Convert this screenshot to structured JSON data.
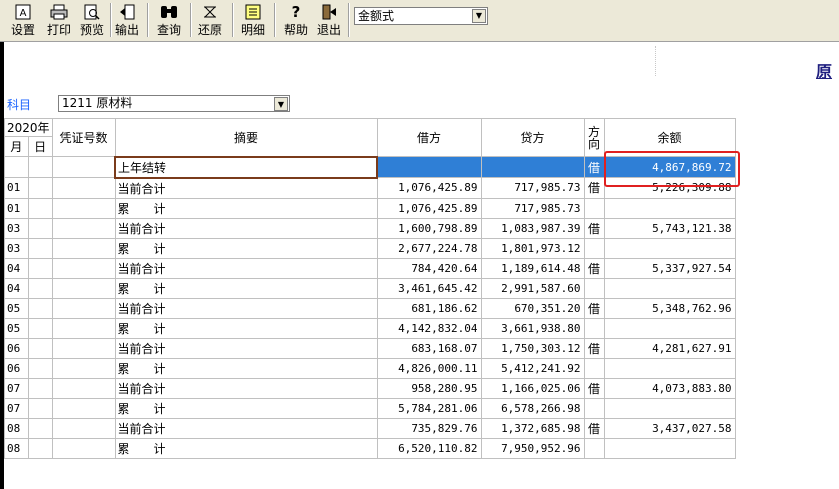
{
  "toolbar": {
    "buttons": [
      {
        "label": "设置",
        "icon": "settings-icon"
      },
      {
        "label": "打印",
        "icon": "printer-icon"
      },
      {
        "label": "预览",
        "icon": "preview-icon"
      },
      {
        "label": "输出",
        "icon": "export-icon"
      },
      {
        "label": "查询",
        "icon": "binoculars-icon"
      },
      {
        "label": "还原",
        "icon": "restore-icon"
      },
      {
        "label": "明细",
        "icon": "detail-icon"
      },
      {
        "label": "帮助",
        "icon": "help-icon"
      },
      {
        "label": "退出",
        "icon": "exit-icon"
      }
    ],
    "format_value": "金额式"
  },
  "title_fragment": "原",
  "account": {
    "label": "科目",
    "value": "1211 原材料"
  },
  "table": {
    "headers": {
      "year": "2020年",
      "month": "月",
      "day": "日",
      "voucher": "凭证号数",
      "summary": "摘要",
      "debit": "借方",
      "credit": "贷方",
      "direction": "方向",
      "balance": "余额"
    },
    "carry": {
      "summary": "上年结转",
      "direction": "借",
      "balance": "4,867,869.72"
    },
    "rows": [
      {
        "month": "01",
        "summary": "当前合计",
        "debit": "1,076,425.89",
        "credit": "717,985.73",
        "direction": "借",
        "balance": "5,226,309.88"
      },
      {
        "month": "01",
        "summary": "累　　计",
        "debit": "1,076,425.89",
        "credit": "717,985.73",
        "direction": "",
        "balance": ""
      },
      {
        "month": "03",
        "summary": "当前合计",
        "debit": "1,600,798.89",
        "credit": "1,083,987.39",
        "direction": "借",
        "balance": "5,743,121.38"
      },
      {
        "month": "03",
        "summary": "累　　计",
        "debit": "2,677,224.78",
        "credit": "1,801,973.12",
        "direction": "",
        "balance": ""
      },
      {
        "month": "04",
        "summary": "当前合计",
        "debit": "784,420.64",
        "credit": "1,189,614.48",
        "direction": "借",
        "balance": "5,337,927.54"
      },
      {
        "month": "04",
        "summary": "累　　计",
        "debit": "3,461,645.42",
        "credit": "2,991,587.60",
        "direction": "",
        "balance": ""
      },
      {
        "month": "05",
        "summary": "当前合计",
        "debit": "681,186.62",
        "credit": "670,351.20",
        "direction": "借",
        "balance": "5,348,762.96"
      },
      {
        "month": "05",
        "summary": "累　　计",
        "debit": "4,142,832.04",
        "credit": "3,661,938.80",
        "direction": "",
        "balance": ""
      },
      {
        "month": "06",
        "summary": "当前合计",
        "debit": "683,168.07",
        "credit": "1,750,303.12",
        "direction": "借",
        "balance": "4,281,627.91"
      },
      {
        "month": "06",
        "summary": "累　　计",
        "debit": "4,826,000.11",
        "credit": "5,412,241.92",
        "direction": "",
        "balance": ""
      },
      {
        "month": "07",
        "summary": "当前合计",
        "debit": "958,280.95",
        "credit": "1,166,025.06",
        "direction": "借",
        "balance": "4,073,883.80"
      },
      {
        "month": "07",
        "summary": "累　　计",
        "debit": "5,784,281.06",
        "credit": "6,578,266.98",
        "direction": "",
        "balance": ""
      },
      {
        "month": "08",
        "summary": "当前合计",
        "debit": "735,829.76",
        "credit": "1,372,685.98",
        "direction": "借",
        "balance": "3,437,027.58"
      },
      {
        "month": "08",
        "summary": "累　　计",
        "debit": "6,520,110.82",
        "credit": "7,950,952.96",
        "direction": "",
        "balance": ""
      }
    ]
  }
}
